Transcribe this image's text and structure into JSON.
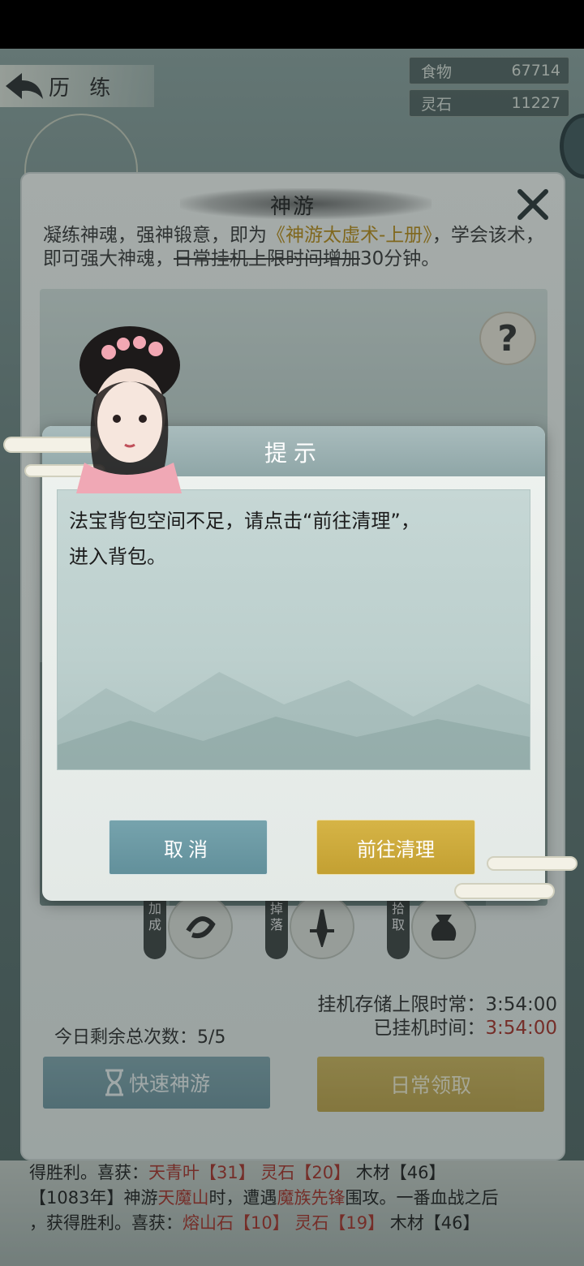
{
  "topbar": {
    "title": "历 练",
    "back_icon": "back-arrow-icon"
  },
  "resources": [
    {
      "name": "食物",
      "value": "67714"
    },
    {
      "name": "灵石",
      "value": "11227"
    }
  ],
  "panel": {
    "title": "神游",
    "desc_prefix": "凝练神魂，强神锻意，即为",
    "desc_book": "《神游太虚术-上册》",
    "desc_mid": "，学会该术，即可强大神魂，",
    "desc_strike": "日常挂机上限时间增加",
    "desc_suffix": "30分钟。",
    "help": "?",
    "skills": [
      {
        "tag": "加成",
        "icon": "swirl-icon"
      },
      {
        "tag": "掉落",
        "icon": "sword-icon"
      },
      {
        "tag": "拾取",
        "icon": "pouch-icon"
      }
    ],
    "remain_label": "今日剩余总次数：5/5",
    "store_limit": "挂机存储上限时常：3:54:00",
    "idle_label": "已挂机时间：",
    "idle_time": "3:54:00",
    "quick_button": "快速神游",
    "daily_button": "日常领取"
  },
  "log": {
    "line1_a": "得胜利。喜获：",
    "line1_b": "天青叶【31】 灵石【20】",
    "line1_c": " 木材【46】",
    "line2_a": "【1083年】神游",
    "line2_b": "天魔山",
    "line2_c": "时，遭遇",
    "line2_d": "魔族先锋",
    "line2_e": "围攻。一番血战之后",
    "line3_a": "，获得胜利。喜获：",
    "line3_b": "熔山石【10】 灵石【19】",
    "line3_c": " 木材【46】"
  },
  "modal": {
    "title": "提示",
    "message_line1": "法宝背包空间不足，请点击“前往清理”，",
    "message_line2": "进入背包。",
    "cancel_button": "取消",
    "goto_button": "前往清理"
  },
  "colors": {
    "accent_gold": "#c3a032",
    "accent_teal": "#62909b",
    "highlight_red": "#a5322a"
  }
}
